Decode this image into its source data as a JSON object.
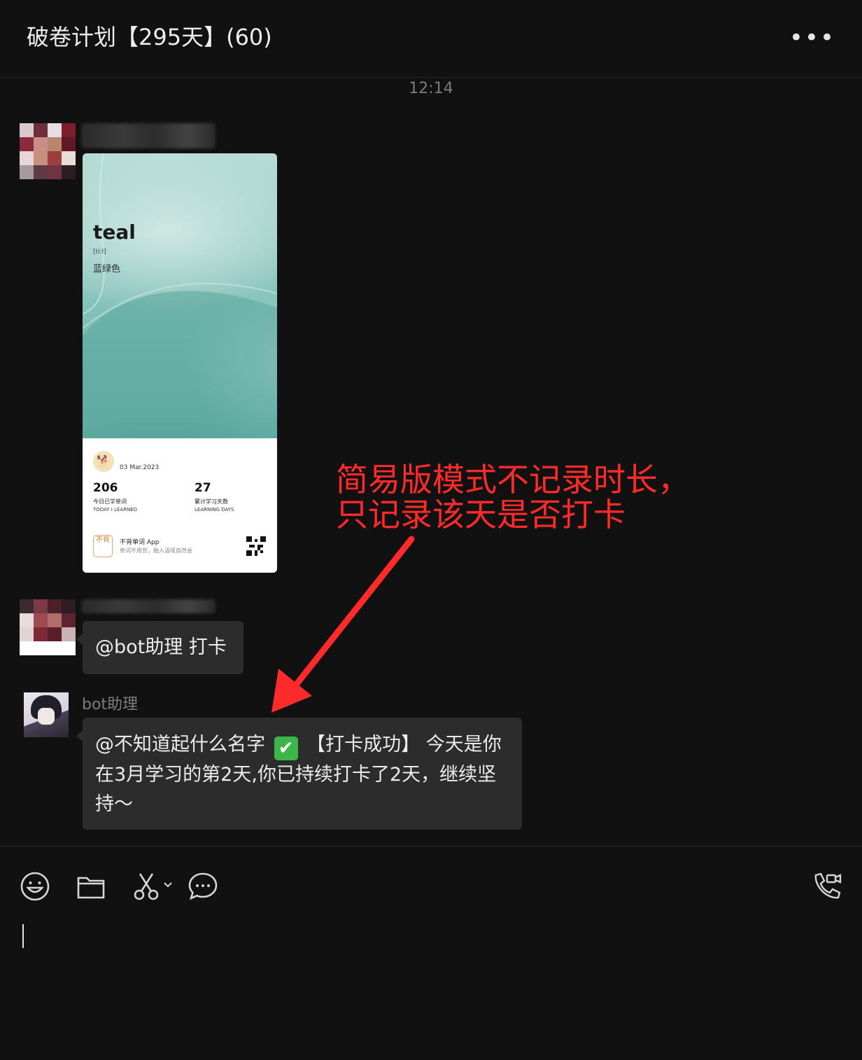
{
  "header": {
    "title": "破卷计划【295天】(60)",
    "more_icon": "more-horizontal-icon"
  },
  "timestamp": "12:14",
  "card": {
    "word": "teal",
    "phonetic": "[tiːl]",
    "meaning": "蓝绿色",
    "date": "03 Mar.2023",
    "stats": [
      {
        "value": "206",
        "label_cn": "今日已学单词",
        "label_en": "TODAY I LEARNED"
      },
      {
        "value": "27",
        "label_cn": "累计学习天数",
        "label_en": "LEARNING DAYS"
      }
    ],
    "app_icon_text": "不背",
    "app_name": "不背单词 App",
    "app_slogan": "单词不用背，融入语境自然会"
  },
  "messages": {
    "checkin_text": "@bot助理 打卡",
    "bot_name": "bot助理",
    "reply_prefix": "@不知道起什么名字",
    "reply_check": "✔",
    "reply_body": " 【打卡成功】 今天是你在3月学习的第2天,你已持续打卡了2天，继续坚持～"
  },
  "annotation": {
    "text": "简易版模式不记录时长，\n只记录该天是否打卡",
    "color": "#ff2a2a"
  },
  "toolbar": {
    "icons": [
      "emoji-icon",
      "folder-icon",
      "scissors-icon",
      "chat-bubble-icon",
      "video-call-icon"
    ]
  },
  "colors": {
    "background": "#111111",
    "bubble": "#2c2c2c",
    "check_green": "#3cb54a"
  }
}
